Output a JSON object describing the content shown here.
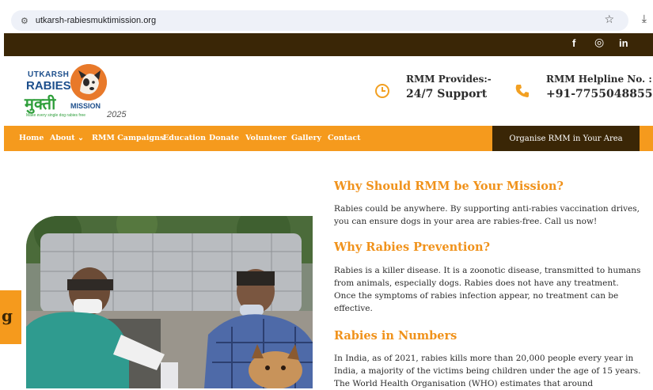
{
  "browser": {
    "url": "utkarsh-rabiesmuktimission.org",
    "site_icon": "site-settings-icon",
    "bookmark_icon": "star-icon",
    "download_icon": "download-icon"
  },
  "topbar": {
    "social": [
      {
        "name": "facebook",
        "glyph": "f"
      },
      {
        "name": "instagram",
        "glyph": "◎"
      },
      {
        "name": "linkedin",
        "glyph": "in"
      }
    ]
  },
  "logo": {
    "line1": "UTKARSH",
    "line2": "RABIES",
    "line3": "मुक्ती",
    "line4": "MISSION",
    "tagline": "Make every single dog rabies free",
    "year": "2025"
  },
  "header": {
    "provides_label": "RMM Provides:-",
    "provides_value": "24/7 Support",
    "helpline_label": "RMM Helpline No. :",
    "helpline_value": "+91-7755048855",
    "clock_icon": "clock-icon",
    "phone_icon": "phone-icon"
  },
  "nav": {
    "items": [
      "Home",
      "About",
      "RMM Campaigns",
      "Education",
      "Donate",
      "Volunteer",
      "Gallery",
      "Contact"
    ],
    "about_chevron": "⌄",
    "cta": "Organise RMM in Your Area"
  },
  "side_tab": {
    "text": "g"
  },
  "content": {
    "h1": "Why Should RMM be Your Mission?",
    "p1": "Rabies could be anywhere. By supporting anti-rabies vaccination drives, you can ensure dogs in your area are rabies-free. Call us now!",
    "h2": "Why Rabies Prevention?",
    "p2": "Rabies is a killer disease. It is a zoonotic disease, transmitted to humans from animals, especially dogs. Rabies does not have any treatment. Once the symptoms of rabies infection appear, no treatment can be effective.",
    "h3": "Rabies in Numbers",
    "p3": "In India, as of 2021, rabies kills more than 20,000 people every year in India, a majority of the victims being children under the age of 15 years. The World Health Organisation (WHO) estimates that around"
  },
  "colors": {
    "accent_orange": "#f59a1d",
    "heading_orange": "#f0921b",
    "dark_brown": "#3a2606",
    "logo_blue": "#1d4f8c",
    "logo_green": "#2e9e3a"
  }
}
